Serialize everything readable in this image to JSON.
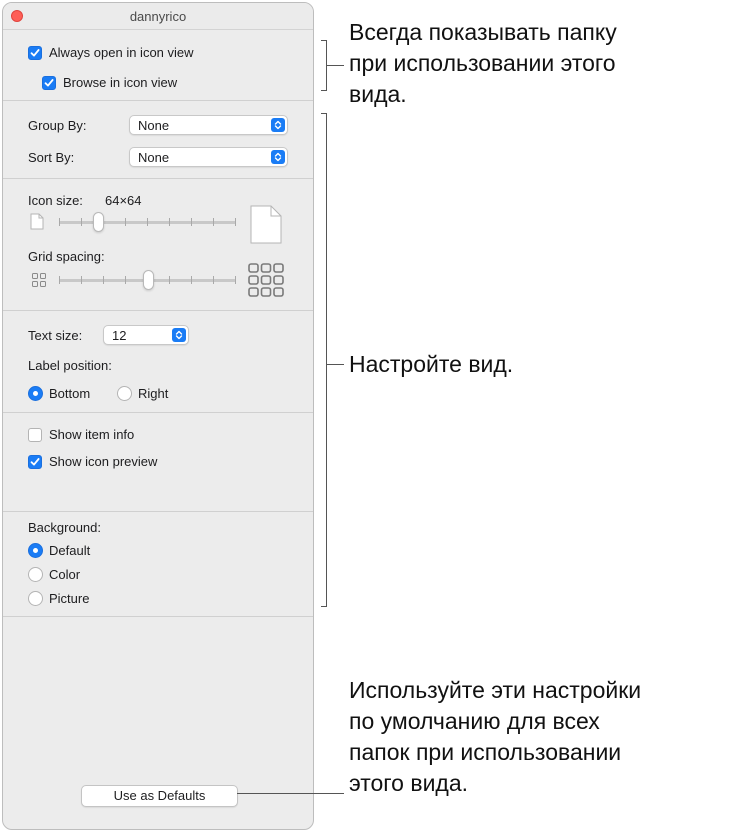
{
  "window": {
    "title": "dannyrico"
  },
  "view_options": {
    "always_open_label": "Always open in icon view",
    "always_open_checked": true,
    "browse_label": "Browse in icon view",
    "browse_checked": true
  },
  "arrange": {
    "group_by_label": "Group By:",
    "group_by_value": "None",
    "sort_by_label": "Sort By:",
    "sort_by_value": "None"
  },
  "icons": {
    "icon_size_label": "Icon size:",
    "icon_size_value": "64×64",
    "icon_size_fraction": 0.22,
    "grid_spacing_label": "Grid spacing:",
    "grid_spacing_fraction": 0.5
  },
  "text": {
    "text_size_label": "Text size:",
    "text_size_value": "12",
    "label_position_label": "Label position:",
    "bottom_label": "Bottom",
    "right_label": "Right",
    "selected_position": "Bottom"
  },
  "info": {
    "show_item_info_label": "Show item info",
    "show_item_info_checked": false,
    "show_icon_preview_label": "Show icon preview",
    "show_icon_preview_checked": true
  },
  "background": {
    "label": "Background:",
    "options": [
      "Default",
      "Color",
      "Picture"
    ],
    "selected": "Default"
  },
  "footer": {
    "defaults_button": "Use as Defaults"
  },
  "callouts": {
    "top": [
      "Всегда показывать папку",
      "при использовании этого",
      "вида."
    ],
    "middle": [
      "Настройте вид."
    ],
    "bottom": [
      "Используйте эти настройки",
      "по умолчанию для всех",
      "папок при использовании",
      "этого вида."
    ]
  },
  "colors": {
    "accent": "#1a7cf5",
    "close": "#fe5f57",
    "window_bg": "#ececec"
  }
}
